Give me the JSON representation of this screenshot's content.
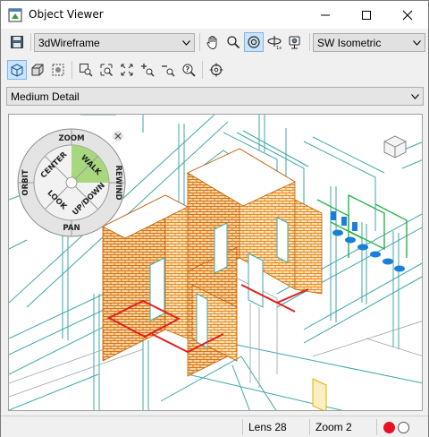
{
  "window": {
    "title": "Object Viewer"
  },
  "toolbar1": {
    "visual_style": "3dWireframe",
    "view_preset": "SW Isometric"
  },
  "toolbar2": {},
  "detail_level": "Medium Detail",
  "nav_wheel": {
    "zoom": "ZOOM",
    "rewind": "REWIND",
    "pan": "PAN",
    "orbit": "ORBIT",
    "center": "CENTER",
    "walk": "WALK",
    "look": "LOOK",
    "updown": "UP/DOWN"
  },
  "status": {
    "lens": "Lens 28",
    "zoom": "Zoom 2"
  },
  "colors": {
    "brick": "#e88a1a",
    "cyan_lines": "#3fa7a7",
    "green_lines": "#2bb24a",
    "blue_fixtures": "#1a7fd8",
    "red_lines": "#e02020",
    "record_red": "#e81123"
  }
}
